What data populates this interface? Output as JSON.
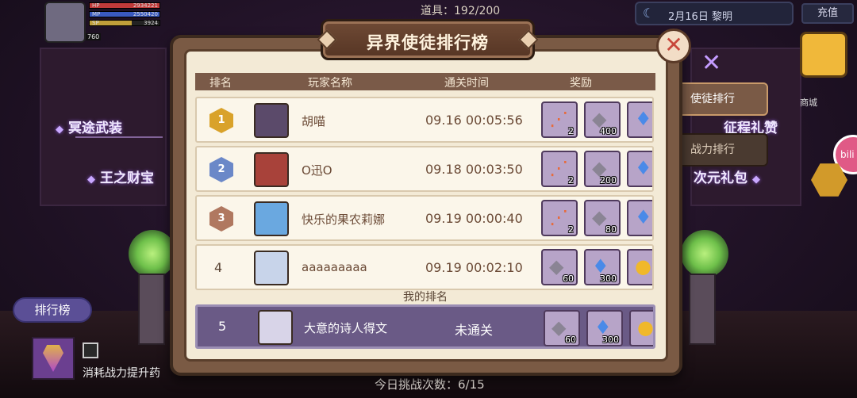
{
  "hud": {
    "hp_label": "HP",
    "hp_value": "2934221",
    "mp_label": "MP",
    "mp_value": "2550420",
    "sp_label": "SP",
    "sp_value": "3924",
    "level": "760",
    "items": "道具：192/200",
    "date": "2月16日 黎明",
    "recharge": "充值"
  },
  "side_labels": {
    "left1": "冥途武装",
    "left2": "王之财宝",
    "right1": "征程礼赞",
    "right2": "次元礼包",
    "right_top": "商城",
    "bili": "bili"
  },
  "bottom": {
    "rank_button": "排行榜",
    "consume": "消耗战力提升药",
    "challenges": "今日挑战次数：6/15"
  },
  "modal": {
    "title": "异界使徒排行榜",
    "close_icon": "close-icon",
    "headers": [
      "排名",
      "玩家名称",
      "通关时间",
      "奖励"
    ],
    "my_rank_label": "我的排名",
    "tabs": [
      "使徒排行",
      "战力排行"
    ]
  },
  "rows": [
    {
      "rank": "1",
      "name": "胡喵",
      "time": "09.16 00:05:56",
      "badge_color": "#d9a22a",
      "avatar_color": "#5b4a6a",
      "rewards": [
        {
          "icon": "feather-icon",
          "count": "2"
        },
        {
          "icon": "ore-icon",
          "count": "400"
        },
        {
          "icon": "diamond-icon",
          "count": "6"
        }
      ]
    },
    {
      "rank": "2",
      "name": "O迅O",
      "time": "09.18 00:03:50",
      "badge_color": "#6b88c8",
      "avatar_color": "#a8423a",
      "rewards": [
        {
          "icon": "feather-icon",
          "count": "2"
        },
        {
          "icon": "ore-icon",
          "count": "200"
        },
        {
          "icon": "diamond-icon",
          "count": "5"
        }
      ]
    },
    {
      "rank": "3",
      "name": "快乐的果农莉娜",
      "time": "09.19 00:00:40",
      "badge_color": "#b07860",
      "avatar_color": "#6aa8e0",
      "rewards": [
        {
          "icon": "feather-icon",
          "count": "2"
        },
        {
          "icon": "ore-icon",
          "count": "80"
        },
        {
          "icon": "diamond-icon",
          "count": "4"
        }
      ]
    },
    {
      "rank": "4",
      "name": "aaaaaaaaa",
      "time": "09.19 00:02:10",
      "avatar_color": "#c8d4ea",
      "rewards": [
        {
          "icon": "ore-icon",
          "count": "60"
        },
        {
          "icon": "diamond-icon",
          "count": "300"
        },
        {
          "icon": "apple-icon",
          "count": ""
        }
      ]
    }
  ],
  "my_row": {
    "rank": "5",
    "name": "大意的诗人得文",
    "time": "未通关",
    "avatar_color": "#d8d4e8",
    "rewards": [
      {
        "icon": "ore-icon",
        "count": "60"
      },
      {
        "icon": "diamond-icon",
        "count": "300"
      },
      {
        "icon": "apple-icon",
        "count": ""
      }
    ]
  }
}
